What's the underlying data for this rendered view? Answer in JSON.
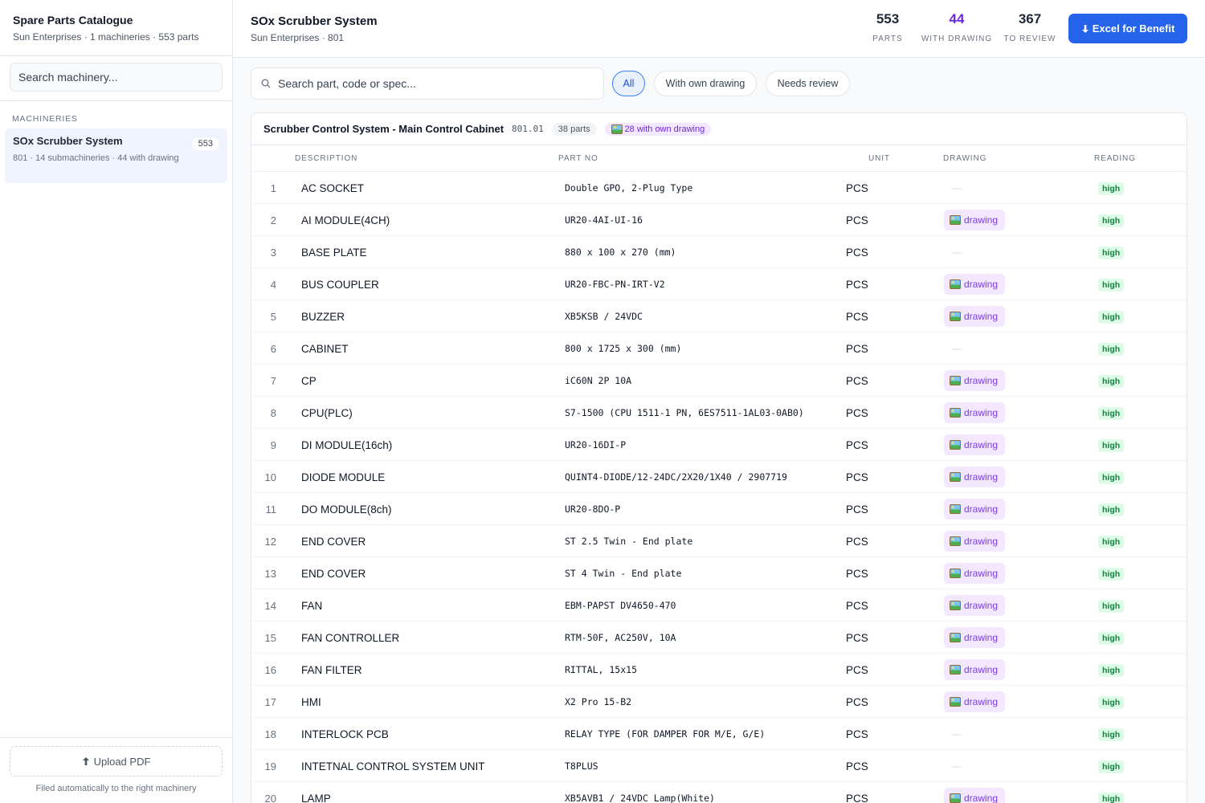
{
  "sidebar": {
    "title": "Spare Parts Catalogue",
    "subtitle": "Sun Enterprises · 1 machineries · 553 parts",
    "search_placeholder": "Search machinery...",
    "section_label": "MACHINERIES",
    "machine": {
      "name": "SOx Scrubber System",
      "meta": "801 · 14 submachineries · 44 with drawing",
      "count": "553"
    },
    "upload_label": "Upload PDF",
    "upload_note": "Filed automatically to the right machinery"
  },
  "header": {
    "title": "SOx Scrubber System",
    "subtitle": "Sun Enterprises · 801",
    "stats": [
      {
        "value": "553",
        "label": "PARTS"
      },
      {
        "value": "44",
        "label": "WITH DRAWING"
      },
      {
        "value": "367",
        "label": "TO REVIEW"
      }
    ],
    "excel_label": "Excel for Benefit"
  },
  "filters": {
    "search_placeholder": "Search part, code or spec...",
    "chips": [
      "All",
      "With own drawing",
      "Needs review"
    ]
  },
  "section": {
    "title": "Scrubber Control System - Main Control Cabinet",
    "code": "801.01",
    "count": "38 parts",
    "drawing_count": "28 with own drawing"
  },
  "table": {
    "columns": [
      "DESCRIPTION",
      "PART NO",
      "UNIT",
      "DRAWING",
      "READING"
    ],
    "drawing_label": "drawing",
    "empty_drawing": "—",
    "rows": [
      {
        "n": "1",
        "desc": "AC SOCKET",
        "part": "Double GPO, 2-Plug Type",
        "unit": "PCS",
        "drawing": false,
        "reading": "high"
      },
      {
        "n": "2",
        "desc": "AI MODULE(4CH)",
        "part": "UR20-4AI-UI-16",
        "unit": "PCS",
        "drawing": true,
        "reading": "high"
      },
      {
        "n": "3",
        "desc": "BASE PLATE",
        "part": "880 x 100 x 270 (mm)",
        "unit": "PCS",
        "drawing": false,
        "reading": "high"
      },
      {
        "n": "4",
        "desc": "BUS COUPLER",
        "part": "UR20-FBC-PN-IRT-V2",
        "unit": "PCS",
        "drawing": true,
        "reading": "high"
      },
      {
        "n": "5",
        "desc": "BUZZER",
        "part": "XB5KSB / 24VDC",
        "unit": "PCS",
        "drawing": true,
        "reading": "high"
      },
      {
        "n": "6",
        "desc": "CABINET",
        "part": "800 x 1725 x 300 (mm)",
        "unit": "PCS",
        "drawing": false,
        "reading": "high"
      },
      {
        "n": "7",
        "desc": "CP",
        "part": "iC60N 2P 10A",
        "unit": "PCS",
        "drawing": true,
        "reading": "high"
      },
      {
        "n": "8",
        "desc": "CPU(PLC)",
        "part": "S7-1500 (CPU 1511-1 PN, 6ES7511-1AL03-0AB0)",
        "unit": "PCS",
        "drawing": true,
        "reading": "high"
      },
      {
        "n": "9",
        "desc": "DI MODULE(16ch)",
        "part": "UR20-16DI-P",
        "unit": "PCS",
        "drawing": true,
        "reading": "high"
      },
      {
        "n": "10",
        "desc": "DIODE MODULE",
        "part": "QUINT4-DIODE/12-24DC/2X20/1X40 / 2907719",
        "unit": "PCS",
        "drawing": true,
        "reading": "high"
      },
      {
        "n": "11",
        "desc": "DO MODULE(8ch)",
        "part": "UR20-8DO-P",
        "unit": "PCS",
        "drawing": true,
        "reading": "high"
      },
      {
        "n": "12",
        "desc": "END COVER",
        "part": "ST 2.5 Twin - End plate",
        "unit": "PCS",
        "drawing": true,
        "reading": "high"
      },
      {
        "n": "13",
        "desc": "END COVER",
        "part": "ST 4 Twin - End plate",
        "unit": "PCS",
        "drawing": true,
        "reading": "high"
      },
      {
        "n": "14",
        "desc": "FAN",
        "part": "EBM-PAPST DV4650-470",
        "unit": "PCS",
        "drawing": true,
        "reading": "high"
      },
      {
        "n": "15",
        "desc": "FAN CONTROLLER",
        "part": "RTM-50F, AC250V, 10A",
        "unit": "PCS",
        "drawing": true,
        "reading": "high"
      },
      {
        "n": "16",
        "desc": "FAN FILTER",
        "part": "RITTAL, 15x15",
        "unit": "PCS",
        "drawing": true,
        "reading": "high"
      },
      {
        "n": "17",
        "desc": "HMI",
        "part": "X2 Pro 15-B2",
        "unit": "PCS",
        "drawing": true,
        "reading": "high"
      },
      {
        "n": "18",
        "desc": "INTERLOCK PCB",
        "part": "RELAY TYPE (FOR DAMPER FOR M/E, G/E)",
        "unit": "PCS",
        "drawing": false,
        "reading": "high"
      },
      {
        "n": "19",
        "desc": "INTETNAL CONTROL SYSTEM UNIT",
        "part": "T8PLUS",
        "unit": "PCS",
        "drawing": false,
        "reading": "high"
      },
      {
        "n": "20",
        "desc": "LAMP",
        "part": "XB5AVB1 / 24VDC Lamp(White)",
        "unit": "PCS",
        "drawing": true,
        "reading": "high"
      }
    ]
  }
}
